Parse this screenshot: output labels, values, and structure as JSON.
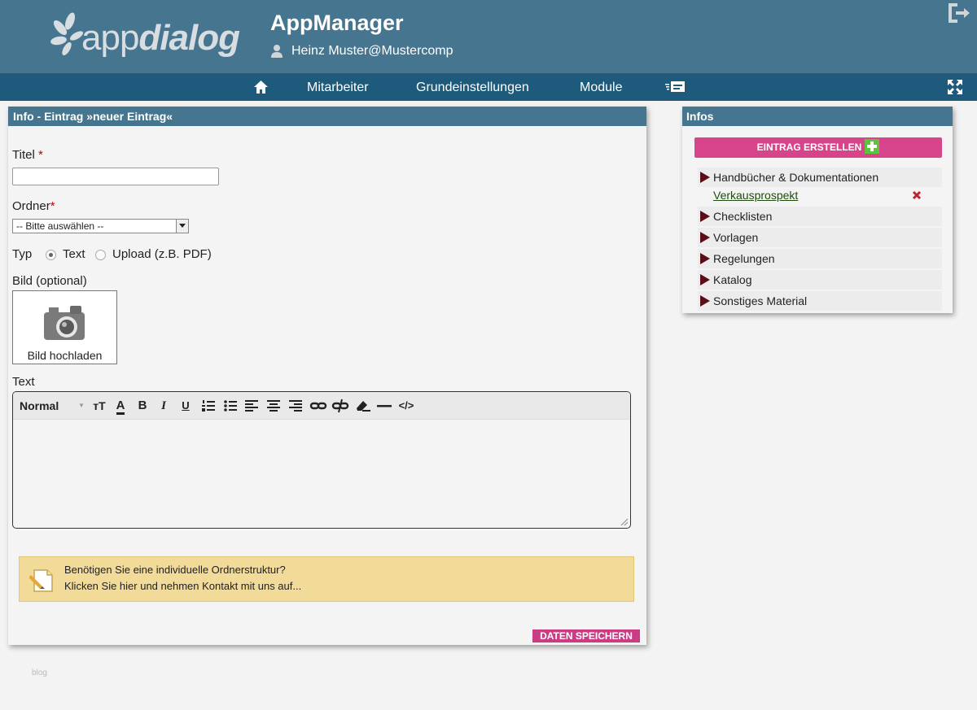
{
  "header": {
    "logo_light": "app",
    "logo_bold": "dialog",
    "app_title": "AppManager",
    "user": "Heinz Muster@Mustercomp"
  },
  "nav": {
    "items": [
      "Mitarbeiter",
      "Grundeinstellungen",
      "Module"
    ]
  },
  "form": {
    "panel_title": "Info - Eintrag »neuer Eintrag«",
    "title_label": "Titel",
    "required_mark": "*",
    "folder_label": "Ordner",
    "folder_select_value": "-- Bitte auswählen --",
    "type_label": "Typ",
    "type_option_text": "Text",
    "type_option_upload": "Upload (z.B. PDF)",
    "image_label": "Bild (optional)",
    "image_upload": "Bild hochladen",
    "text_label": "Text",
    "editor_format": "Normal",
    "notice_line1": "Benötigen Sie eine individuelle Ordnerstruktur?",
    "notice_line2": "Klicken Sie hier und nehmen Kontakt mit uns auf...",
    "save_button": "DATEN SPEICHERN"
  },
  "side": {
    "title": "Infos",
    "create_button": "EINTRAG ERSTELLEN",
    "folders": [
      "Handbücher & Dokumentationen",
      "Checklisten",
      "Vorlagen",
      "Regelungen",
      "Katalog",
      "Sonstiges Material"
    ],
    "sub_item": "Verkausprospekt"
  },
  "footer": {
    "text": "blog"
  },
  "colors": {
    "header_bg": "#46758f",
    "nav_bg": "#1e5a7b",
    "accent_pink": "#d8448b",
    "notice_bg": "#f2da98"
  }
}
